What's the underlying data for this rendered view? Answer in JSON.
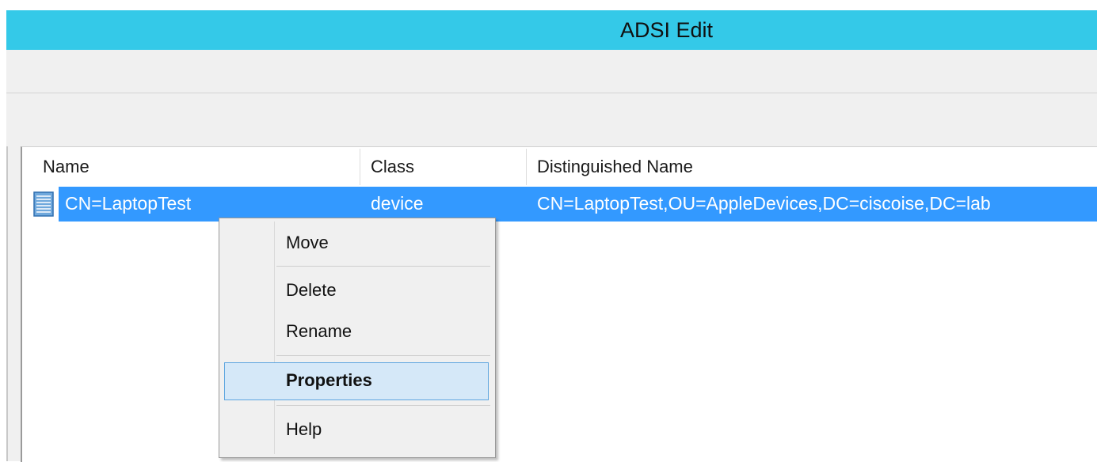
{
  "window": {
    "title": "ADSI Edit"
  },
  "list": {
    "columns": [
      "Name",
      "Class",
      "Distinguished Name"
    ],
    "rows": [
      {
        "name": "CN=LaptopTest",
        "class": "device",
        "dn": "CN=LaptopTest,OU=AppleDevices,DC=ciscoise,DC=lab",
        "selected": true,
        "icon": "device-object-icon"
      }
    ]
  },
  "context_menu": {
    "items": [
      {
        "label": "Move"
      },
      {
        "label": "Delete"
      },
      {
        "label": "Rename"
      },
      {
        "label": "Properties",
        "highlighted": true,
        "bold": true
      },
      {
        "label": "Help"
      }
    ]
  },
  "colors": {
    "titlebar": "#34c9e8",
    "selection": "#3399ff",
    "menu_hover": "#d5e8f8"
  }
}
